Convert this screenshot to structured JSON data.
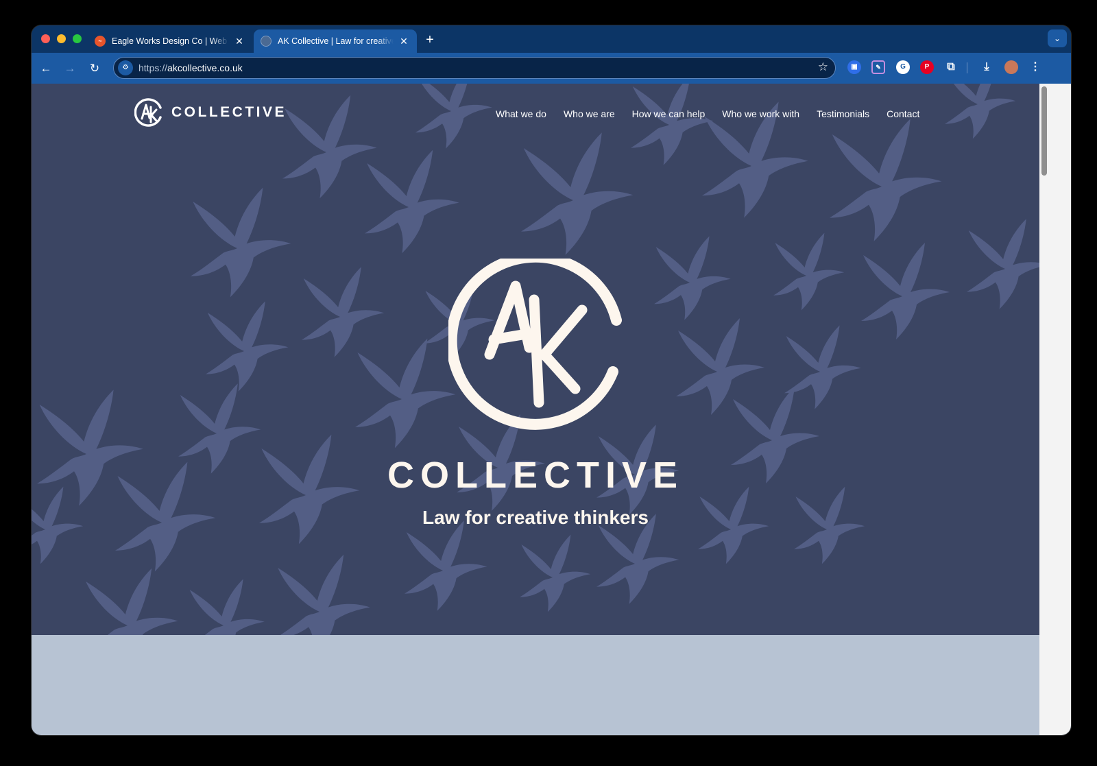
{
  "browser": {
    "tabs": [
      {
        "title": "Eagle Works Design Co | Web",
        "favicon": "eagle-icon",
        "active": false
      },
      {
        "title": "AK Collective | Law for creative thinkers",
        "favicon": "globe-icon",
        "active": true
      }
    ],
    "url_protocol": "https://",
    "url_host": "akcollective.co.uk",
    "colors": {
      "tabstrip": "#0c3566",
      "toolbar": "#1c5aa3",
      "omnibox": "#082448"
    }
  },
  "site": {
    "logo_text": "COLLECTIVE",
    "logo_mark": "AK",
    "nav": [
      "What we do",
      "Who we are",
      "How we can help",
      "Who we work with",
      "Testimonials",
      "Contact"
    ],
    "hero": {
      "name": "COLLECTIVE",
      "tagline": "Law for creative thinkers"
    },
    "colors": {
      "hero_bg": "#3b4563",
      "bird": "#56618a",
      "logo": "#fdf6ee",
      "lower_bg": "#b7c3d3"
    }
  }
}
